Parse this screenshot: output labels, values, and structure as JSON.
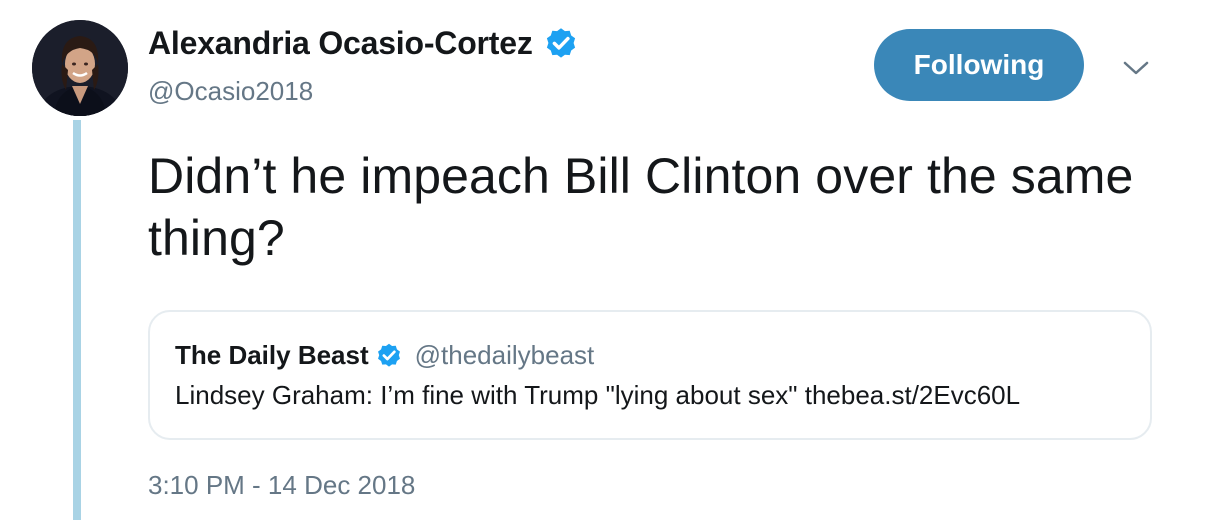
{
  "author": {
    "display_name": "Alexandria Ocasio-Cortez",
    "handle": "@Ocasio2018",
    "verified_icon": "verified-badge-icon"
  },
  "follow_button": {
    "label": "Following"
  },
  "menu_caret": {
    "icon": "chevron-down-icon"
  },
  "tweet": {
    "text": "Didn’t he impeach Bill Clinton over the same thing?",
    "timestamp": "3:10 PM - 14 Dec 2018"
  },
  "quoted_tweet": {
    "display_name": "The Daily Beast",
    "handle": "@thedailybeast",
    "text": "Lindsey Graham: I’m fine with Trump \"lying about sex\" thebea.st/2Evc60L"
  },
  "colors": {
    "accent": "#3a87b8",
    "verified": "#1da1f2",
    "thread_line": "#a9d3e5",
    "muted_text": "#657786",
    "border": "#e6ecf0"
  }
}
